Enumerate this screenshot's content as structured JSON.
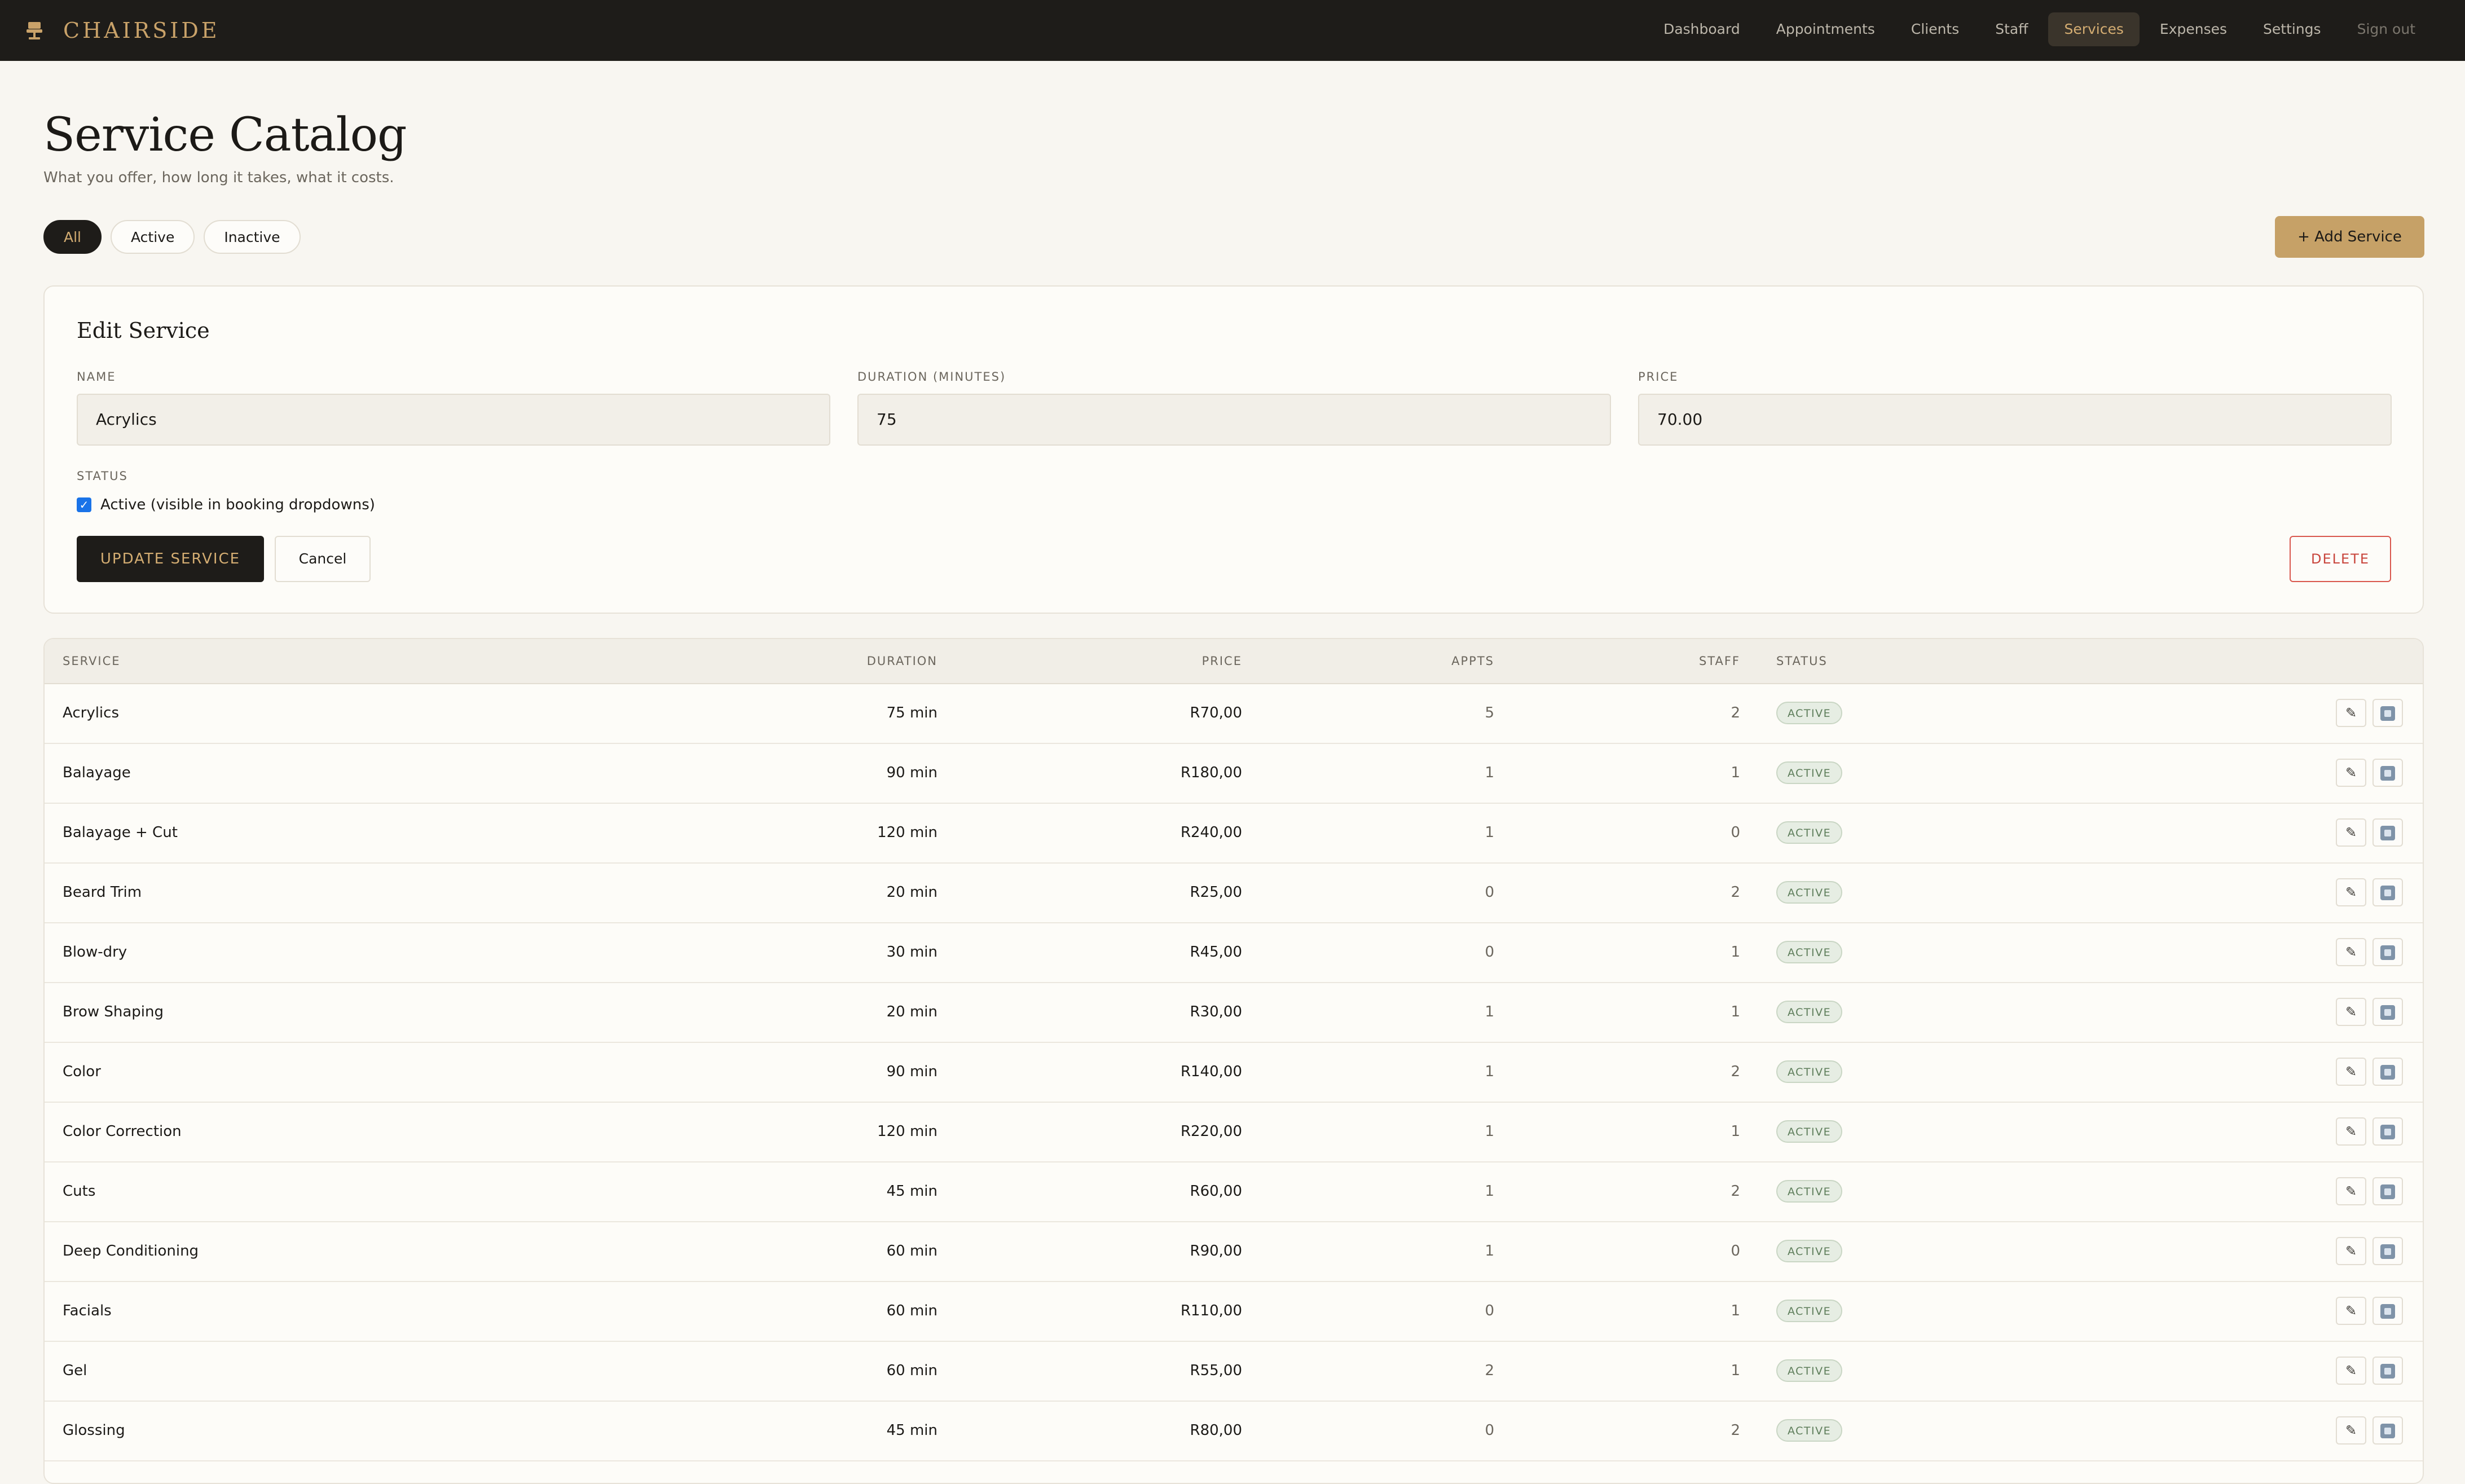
{
  "app": {
    "brand": "CHAIRSIDE",
    "brand_icon": "salon-chair-icon",
    "accent_color": "#c9a269"
  },
  "nav": {
    "items": [
      "Dashboard",
      "Appointments",
      "Clients",
      "Staff",
      "Services",
      "Expenses",
      "Settings",
      "Sign out"
    ],
    "active": "Services"
  },
  "header": {
    "title": "Service Catalog",
    "subtitle": "What you offer, how long it takes, what it costs."
  },
  "filters": {
    "options": [
      "All",
      "Active",
      "Inactive"
    ],
    "selected": "All"
  },
  "add_button": "+ Add Service",
  "edit_form": {
    "title": "Edit Service",
    "name_label": "NAME",
    "name_value": "Acrylics",
    "duration_label": "DURATION (MINUTES)",
    "duration_value": "75",
    "price_label": "PRICE",
    "price_value": "70.00",
    "status_label": "STATUS",
    "active_checked": true,
    "active_label": "Active (visible in booking dropdowns)",
    "update_label": "UPDATE SERVICE",
    "cancel_label": "Cancel",
    "delete_label": "DELETE"
  },
  "table": {
    "columns": [
      "SERVICE",
      "DURATION",
      "PRICE",
      "APPTS",
      "STAFF",
      "STATUS"
    ],
    "rows": [
      {
        "service": "Acrylics",
        "duration": "75 min",
        "price": "R70,00",
        "appts": "5",
        "staff": "2",
        "status": "ACTIVE"
      },
      {
        "service": "Balayage",
        "duration": "90 min",
        "price": "R180,00",
        "appts": "1",
        "staff": "1",
        "status": "ACTIVE"
      },
      {
        "service": "Balayage + Cut",
        "duration": "120 min",
        "price": "R240,00",
        "appts": "1",
        "staff": "0",
        "status": "ACTIVE"
      },
      {
        "service": "Beard Trim",
        "duration": "20 min",
        "price": "R25,00",
        "appts": "0",
        "staff": "2",
        "status": "ACTIVE"
      },
      {
        "service": "Blow-dry",
        "duration": "30 min",
        "price": "R45,00",
        "appts": "0",
        "staff": "1",
        "status": "ACTIVE"
      },
      {
        "service": "Brow Shaping",
        "duration": "20 min",
        "price": "R30,00",
        "appts": "1",
        "staff": "1",
        "status": "ACTIVE"
      },
      {
        "service": "Color",
        "duration": "90 min",
        "price": "R140,00",
        "appts": "1",
        "staff": "2",
        "status": "ACTIVE"
      },
      {
        "service": "Color Correction",
        "duration": "120 min",
        "price": "R220,00",
        "appts": "1",
        "staff": "1",
        "status": "ACTIVE"
      },
      {
        "service": "Cuts",
        "duration": "45 min",
        "price": "R60,00",
        "appts": "1",
        "staff": "2",
        "status": "ACTIVE"
      },
      {
        "service": "Deep Conditioning",
        "duration": "60 min",
        "price": "R90,00",
        "appts": "1",
        "staff": "0",
        "status": "ACTIVE"
      },
      {
        "service": "Facials",
        "duration": "60 min",
        "price": "R110,00",
        "appts": "0",
        "staff": "1",
        "status": "ACTIVE"
      },
      {
        "service": "Gel",
        "duration": "60 min",
        "price": "R55,00",
        "appts": "2",
        "staff": "1",
        "status": "ACTIVE"
      },
      {
        "service": "Glossing",
        "duration": "45 min",
        "price": "R80,00",
        "appts": "0",
        "staff": "2",
        "status": "ACTIVE"
      }
    ],
    "row_actions": [
      "edit-icon",
      "delete-icon"
    ]
  }
}
